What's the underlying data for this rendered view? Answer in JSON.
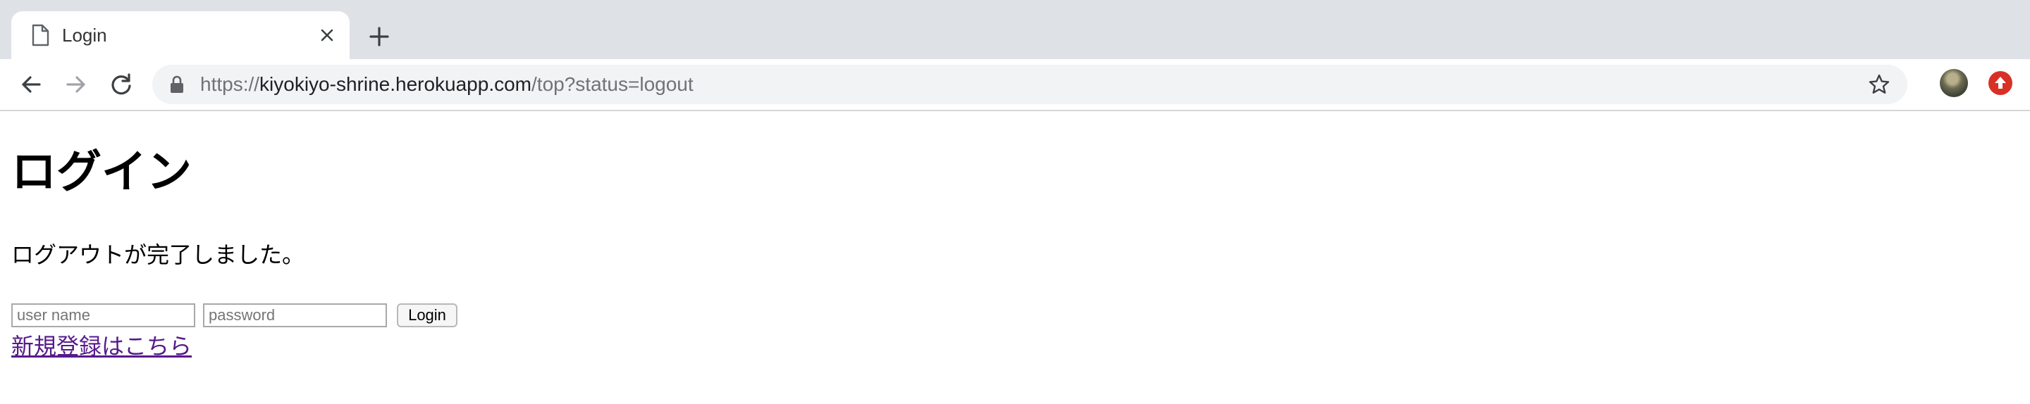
{
  "browser": {
    "tab": {
      "title": "Login",
      "icon": "document-icon"
    },
    "address": {
      "scheme": "https://",
      "host": "kiyokiyo-shrine.herokuapp.com",
      "path": "/top?status=logout"
    },
    "icons": [
      "back-icon",
      "forward-icon",
      "reload-icon",
      "lock-icon",
      "star-icon",
      "new-tab-icon",
      "close-icon",
      "update-icon"
    ]
  },
  "page": {
    "heading": "ログイン",
    "message": "ログアウトが完了しました。",
    "form": {
      "username_placeholder": "user name",
      "username_value": "",
      "password_placeholder": "password",
      "password_value": "",
      "submit_label": "Login"
    },
    "signup_link": "新規登録はこちら"
  },
  "colors": {
    "tabstrip_bg": "#dee1e6",
    "omnibox_bg": "#f1f3f4",
    "visited_link": "#551a8b",
    "update_badge": "#d93025"
  }
}
